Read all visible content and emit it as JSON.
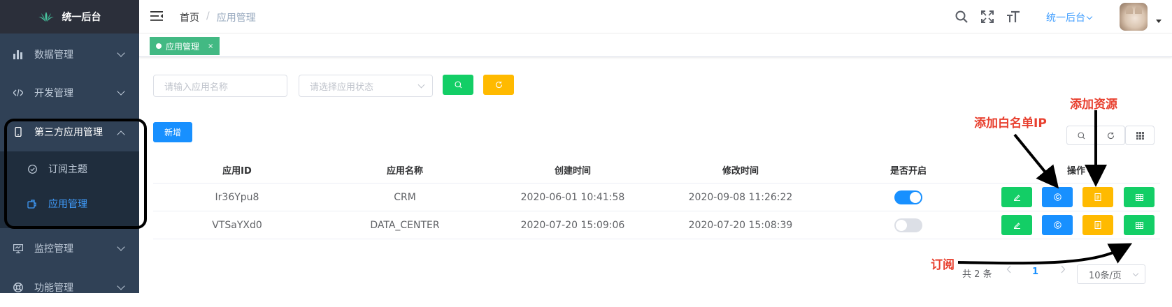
{
  "sidebar": {
    "logo_text": "统一后台",
    "menu": [
      {
        "label": "数据管理",
        "icon": "bar-chart-icon"
      },
      {
        "label": "开发管理",
        "icon": "code-icon"
      },
      {
        "label": "第三方应用管理",
        "icon": "mobile-icon"
      },
      {
        "label": "监控管理",
        "icon": "monitor-icon"
      },
      {
        "label": "功能管理",
        "icon": "lifebuoy-icon"
      }
    ],
    "submenu": [
      {
        "label": "订阅主题",
        "icon": "check-circle-icon"
      },
      {
        "label": "应用管理",
        "icon": "app-icon"
      }
    ]
  },
  "header": {
    "breadcrumb_home": "首页",
    "breadcrumb_sep": "/",
    "breadcrumb_current": "应用管理",
    "system_name": "统一后台"
  },
  "tags": {
    "active_tag": "应用管理",
    "close": "×"
  },
  "filters": {
    "name_placeholder": "请输入应用名称",
    "status_placeholder": "请选择应用状态"
  },
  "actions": {
    "add_label": "新增"
  },
  "table": {
    "columns": [
      "应用ID",
      "应用名称",
      "创建时间",
      "修改时间",
      "是否开启",
      "操作"
    ],
    "rows": [
      {
        "id": "Ir36Ypu8",
        "name": "CRM",
        "created": "2020-06-01 10:41:58",
        "modified": "2020-09-08 11:26:22",
        "enabled": true
      },
      {
        "id": "VTSaYXd0",
        "name": "DATA_CENTER",
        "created": "2020-07-20 15:09:06",
        "modified": "2020-07-20 15:08:39",
        "enabled": false
      }
    ]
  },
  "pagination": {
    "total_text": "共 2 条",
    "current_page": "1",
    "page_size": "10条/页"
  },
  "annotations": {
    "whitelist": "添加白名单IP",
    "resource": "添加资源",
    "subscribe": "订阅"
  },
  "colors": {
    "sidebar_bg": "#304156",
    "accent": "#1890ff",
    "green": "#13ce66",
    "orange": "#ffba00",
    "annotation_red": "#e8402f"
  }
}
